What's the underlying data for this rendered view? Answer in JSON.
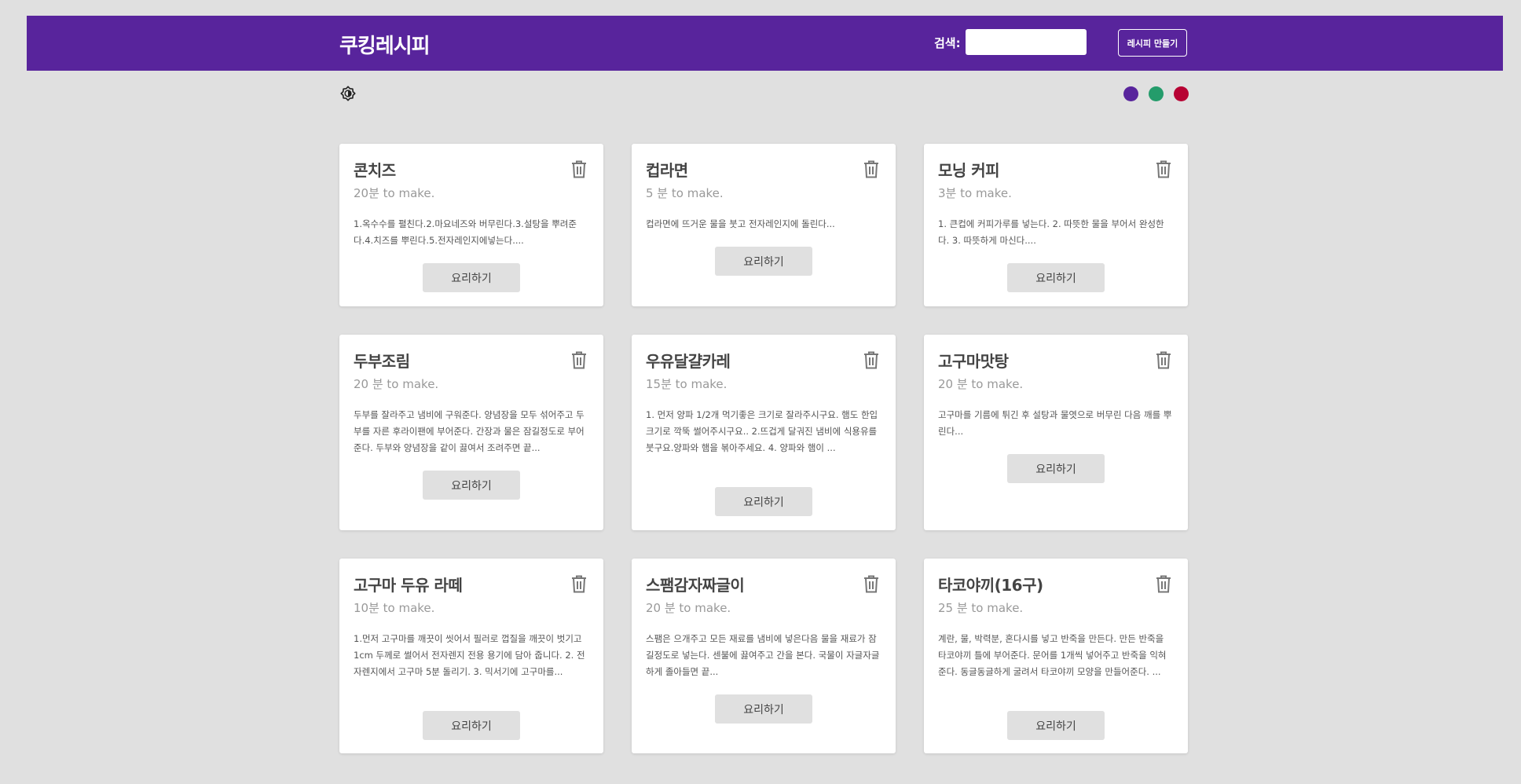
{
  "header": {
    "brand": "쿠킹레시피",
    "search_label": "검색:",
    "search_value": "",
    "create_button": "레시피 만들기"
  },
  "theme_colors": [
    "#58249c",
    "#249c6b",
    "#b70233"
  ],
  "recipes": [
    {
      "title": "콘치즈",
      "time": "20분 to make.",
      "method": "1.옥수수를 펼친다.2.마요네즈와 버무린다.3.설탕을 뿌려준다.4.치즈를 뿌린다.5.전자레인지에넣는다....",
      "button": "요리하기"
    },
    {
      "title": "컵라면",
      "time": "5 분 to make.",
      "method": "컵라면에 뜨거운 물을 붓고 전자레인지에 돌린다...",
      "button": "요리하기"
    },
    {
      "title": "모닝 커피",
      "time": "3분 to make.",
      "method": "1. 큰컵에 커피가루를 넣는다. 2. 따뜻한 물을 부어서 완성한다. 3. 따뜻하게 마신다....",
      "button": "요리하기"
    },
    {
      "title": "두부조림",
      "time": "20 분 to make.",
      "method": "두부를 잘라주고 냄비에 구워준다. 양념장을 모두 섞어주고 두부를 자른 후라이팬에 부어준다. 간장과 물은 잠길정도로 부어준다. 두부와 양념장을 같이 끓여서 조려주면 끝...",
      "button": "요리하기"
    },
    {
      "title": "우유달걀카레",
      "time": "15분 to make.",
      "method": "1. 먼저 양파 1/2개 먹기좋은 크기로 잘라주시구요. 햄도 한입 크기로 깍뚝 썰어주시구요.. 2.뜨겁게 달궈진 냄비에 식용유를 붓구요.양파와 햄을 볶아주세요. 4. 양파와 햄이 ...",
      "button": "요리하기"
    },
    {
      "title": "고구마맛탕",
      "time": "20 분 to make.",
      "method": "고구마를 기름에 튀긴 후 설탕과 물엿으로 버무린 다음 깨를 뿌린다...",
      "button": "요리하기"
    },
    {
      "title": "고구마 두유 라떼",
      "time": "10분 to make.",
      "method": "1.먼저 고구마를 깨끗이 씻어서 필러로 껍질을 깨끗이 벗기고 1cm 두께로 썰어서 전자렌지 전용 용기에 담아 줍니다. 2. 전자렌지에서 고구마 5분 돌리기. 3. 믹서기에 고구마를...",
      "button": "요리하기"
    },
    {
      "title": "스팸감자짜글이",
      "time": "20 분 to make.",
      "method": "스팸은 으개주고 모든 재료를 냄비에 넣은다음 물을 재료가 잠길정도로 넣는다. 센불에 끓여주고 간을 본다. 국물이 자글자글하게 졸아들면 끝...",
      "button": "요리하기"
    },
    {
      "title": "타코야끼(16구)",
      "time": "25 분 to make.",
      "method": "계란, 물, 박력분, 혼다시를 넣고 반죽을 만든다. 만든 반죽을 타코야끼 틀에 부어준다. 문어를 1개씩 넣어주고 반죽을 익혀준다. 동글동글하게 굴려서 타코야끼 모양을 만들어준다. ...",
      "button": "요리하기"
    }
  ]
}
